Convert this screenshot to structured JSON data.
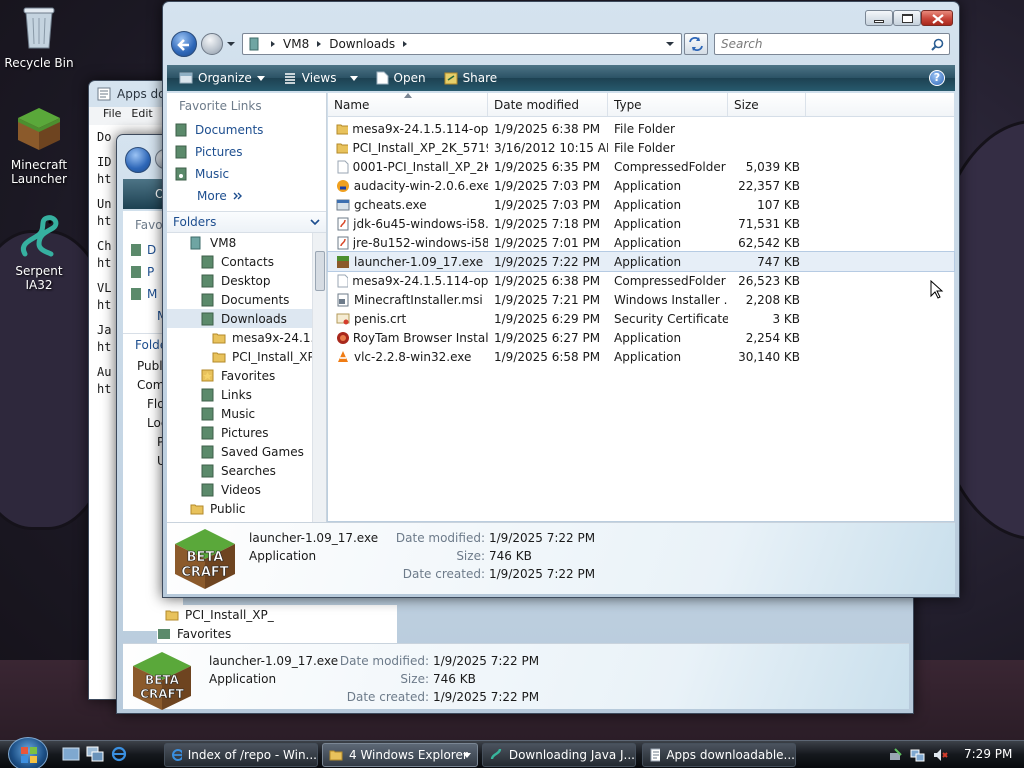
{
  "desktop": {
    "icons": [
      {
        "label": "Recycle Bin"
      },
      {
        "label": "Minecraft Launcher"
      },
      {
        "label": "Serpent IA32"
      }
    ]
  },
  "back_window_2": {
    "title": "Apps do",
    "menu": [
      "File",
      "Edit"
    ],
    "lines": [
      "Do",
      "ID",
      "ht",
      "Un",
      "ht",
      "Ch",
      "ht",
      "VL",
      "ht",
      "Ja",
      "ht",
      "Au",
      "ht"
    ]
  },
  "back_window_1": {
    "toolbar_text": "O",
    "favorite_items": [
      "Favo",
      "D",
      "P",
      "M",
      "M"
    ],
    "folder_header": "Folde",
    "tree": [
      "Publi",
      "Com",
      "Flo",
      "Loc",
      "P",
      "U",
      "",
      "",
      "",
      "",
      "",
      "",
      "",
      "PCI_Install_XP_",
      "Favorites"
    ],
    "details": {
      "name": "launcher-1.09_17.exe",
      "type": "Application",
      "modified_label": "Date modified:",
      "modified": "1/9/2025 7:22 PM",
      "size_label": "Size:",
      "size": "746 KB",
      "created_label": "Date created:",
      "created": "1/9/2025 7:22 PM",
      "thumb_text": "BETA CRAFT"
    }
  },
  "main": {
    "address": [
      "VM8",
      "Downloads"
    ],
    "search_placeholder": "Search",
    "toolbar": [
      "Organize",
      "Views",
      "Open",
      "Share"
    ],
    "favorite_links_header": "Favorite Links",
    "favorite_links": [
      "Documents",
      "Pictures",
      "Music"
    ],
    "more": "More",
    "folders_header": "Folders",
    "tree": [
      {
        "label": "VM8",
        "indent": 1,
        "icon": "computer"
      },
      {
        "label": "Contacts",
        "indent": 2,
        "icon": "contacts"
      },
      {
        "label": "Desktop",
        "indent": 2,
        "icon": "desktop"
      },
      {
        "label": "Documents",
        "indent": 2,
        "icon": "documents"
      },
      {
        "label": "Downloads",
        "indent": 2,
        "icon": "downloads",
        "selected": true
      },
      {
        "label": "mesa9x-24.1.5.",
        "indent": 3,
        "icon": "folder"
      },
      {
        "label": "PCI_Install_XP_",
        "indent": 3,
        "icon": "folder"
      },
      {
        "label": "Favorites",
        "indent": 2,
        "icon": "favorites"
      },
      {
        "label": "Links",
        "indent": 2,
        "icon": "links"
      },
      {
        "label": "Music",
        "indent": 2,
        "icon": "music"
      },
      {
        "label": "Pictures",
        "indent": 2,
        "icon": "pictures"
      },
      {
        "label": "Saved Games",
        "indent": 2,
        "icon": "saved-games"
      },
      {
        "label": "Searches",
        "indent": 2,
        "icon": "searches"
      },
      {
        "label": "Videos",
        "indent": 2,
        "icon": "videos"
      },
      {
        "label": "Public",
        "indent": 1,
        "icon": "folder"
      }
    ],
    "columns": [
      "Name",
      "Date modified",
      "Type",
      "Size"
    ],
    "files": [
      {
        "name": "mesa9x-24.1.5.114-ope...",
        "date": "1/9/2025 6:38 PM",
        "type": "File Folder",
        "size": "",
        "icon": "folder"
      },
      {
        "name": "PCI_Install_XP_2K_5719...",
        "date": "3/16/2012 10:15 AM",
        "type": "File Folder",
        "size": "",
        "icon": "folder"
      },
      {
        "name": "0001-PCI_Install_XP_2K...",
        "date": "1/9/2025 6:35 PM",
        "type": "CompressedFolder",
        "size": "5,039 KB",
        "icon": "file"
      },
      {
        "name": "audacity-win-2.0.6.exe",
        "date": "1/9/2025 7:03 PM",
        "type": "Application",
        "size": "22,357 KB",
        "icon": "audacity"
      },
      {
        "name": "gcheats.exe",
        "date": "1/9/2025 7:03 PM",
        "type": "Application",
        "size": "107 KB",
        "icon": "app"
      },
      {
        "name": "jdk-6u45-windows-i58...",
        "date": "1/9/2025 7:18 PM",
        "type": "Application",
        "size": "71,531 KB",
        "icon": "java"
      },
      {
        "name": "jre-8u152-windows-i58...",
        "date": "1/9/2025 7:01 PM",
        "type": "Application",
        "size": "62,542 KB",
        "icon": "java"
      },
      {
        "name": "launcher-1.09_17.exe",
        "date": "1/9/2025 7:22 PM",
        "type": "Application",
        "size": "747 KB",
        "icon": "launcher",
        "selected": true
      },
      {
        "name": "mesa9x-24.1.5.114-ope...",
        "date": "1/9/2025 6:38 PM",
        "type": "CompressedFolder",
        "size": "26,523 KB",
        "icon": "file"
      },
      {
        "name": "MinecraftInstaller.msi",
        "date": "1/9/2025 7:21 PM",
        "type": "Windows Installer ...",
        "size": "2,208 KB",
        "icon": "msi"
      },
      {
        "name": "penis.crt",
        "date": "1/9/2025 6:29 PM",
        "type": "Security Certificate",
        "size": "3 KB",
        "icon": "cert"
      },
      {
        "name": "RoyTam Browser Instal...",
        "date": "1/9/2025 6:27 PM",
        "type": "Application",
        "size": "2,254 KB",
        "icon": "roytam"
      },
      {
        "name": "vlc-2.2.8-win32.exe",
        "date": "1/9/2025 6:58 PM",
        "type": "Application",
        "size": "30,140 KB",
        "icon": "vlc"
      }
    ],
    "details": {
      "name": "launcher-1.09_17.exe",
      "type": "Application",
      "modified_label": "Date modified:",
      "modified": "1/9/2025 7:22 PM",
      "size_label": "Size:",
      "size": "746 KB",
      "created_label": "Date created:",
      "created": "1/9/2025 7:22 PM",
      "thumb_text": "BETA CRAFT"
    }
  },
  "taskbar": {
    "buttons": [
      {
        "label": "Index of /repo - Win...",
        "icon": "ie-icon"
      },
      {
        "label": "4 Windows Explorer",
        "icon": "folder-icon",
        "active": true
      },
      {
        "label": "Downloading Java J...",
        "icon": "java-icon"
      },
      {
        "label": "Apps downloadable...",
        "icon": "notepad-icon"
      }
    ],
    "clock": "7:29 PM"
  },
  "colors": {
    "accent": "#2e67b8",
    "selection": "#e6eef7",
    "toolbar": "#275a6d",
    "close": "#c8463a"
  }
}
